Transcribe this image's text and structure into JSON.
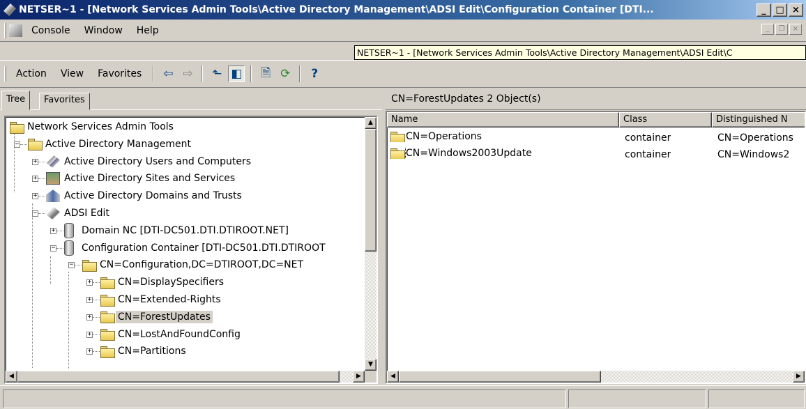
{
  "window": {
    "title": "NETSER~1 - [Network Services Admin Tools\\Active Directory Management\\ADSI Edit\\Configuration Container [DTI...",
    "app_icon": "mmc-icon",
    "buttons": {
      "minimize": "_",
      "maximize": "□",
      "close": "×"
    }
  },
  "menubar": {
    "items": [
      {
        "label": "Console",
        "icon": "console-icon"
      },
      {
        "label": "Window"
      },
      {
        "label": "Help"
      }
    ]
  },
  "tooltip": {
    "text": "NETSER~1 - [Network Services Admin Tools\\Active Directory Management\\ADSI Edit\\C"
  },
  "toolbar": {
    "menu_items": [
      "Action",
      "View",
      "Favorites"
    ],
    "buttons": [
      {
        "icon": "back-arrow-icon",
        "glyph": "⇦"
      },
      {
        "icon": "forward-arrow-icon",
        "glyph": "⇨"
      },
      {
        "icon": "up-one-level-icon",
        "glyph": "⬑"
      },
      {
        "icon": "show-hide-tree-icon",
        "glyph": "◧",
        "pressed": true
      },
      {
        "icon": "properties-icon",
        "glyph": "🗎"
      },
      {
        "icon": "refresh-icon",
        "glyph": "⟳"
      },
      {
        "icon": "help-icon",
        "glyph": "?"
      }
    ]
  },
  "left_pane": {
    "tabs": [
      {
        "label": "Tree",
        "active": true
      },
      {
        "label": "Favorites",
        "active": false
      }
    ],
    "tree": [
      {
        "label": "Network Services Admin Tools",
        "icon": "folder-icon",
        "level": 0,
        "expander": ""
      },
      {
        "label": "Active Directory Management",
        "icon": "folder-icon",
        "level": 1,
        "expander": "-"
      },
      {
        "label": "Active Directory Users and Computers",
        "icon": "ad-users-computers-icon",
        "level": 2,
        "expander": "+"
      },
      {
        "label": "Active Directory Sites and Services",
        "icon": "ad-sites-services-icon",
        "level": 2,
        "expander": "+"
      },
      {
        "label": "Active Directory Domains and Trusts",
        "icon": "ad-domains-trusts-icon",
        "level": 2,
        "expander": "+"
      },
      {
        "label": "ADSI Edit",
        "icon": "adsi-edit-icon",
        "level": 2,
        "expander": "-"
      },
      {
        "label": "Domain NC [DTI-DC501.DTI.DTIROOT.NET]",
        "icon": "naming-context-icon",
        "level": 3,
        "expander": "+"
      },
      {
        "label": "Configuration Container [DTI-DC501.DTI.DTIROOT",
        "icon": "naming-context-icon",
        "level": 3,
        "expander": "-"
      },
      {
        "label": "CN=Configuration,DC=DTIROOT,DC=NET",
        "icon": "folder-icon",
        "level": 4,
        "expander": "-"
      },
      {
        "label": "CN=DisplaySpecifiers",
        "icon": "folder-icon",
        "level": 5,
        "expander": "+"
      },
      {
        "label": "CN=Extended-Rights",
        "icon": "folder-icon",
        "level": 5,
        "expander": "+"
      },
      {
        "label": "CN=ForestUpdates",
        "icon": "folder-icon",
        "level": 5,
        "expander": "+",
        "selected": true
      },
      {
        "label": "CN=LostAndFoundConfig",
        "icon": "folder-icon",
        "level": 5,
        "expander": "+"
      },
      {
        "label": "CN=Partitions",
        "icon": "folder-icon",
        "level": 5,
        "expander": "+"
      }
    ]
  },
  "right_pane": {
    "header": "CN=ForestUpdates   2 Object(s)",
    "columns": [
      "Name",
      "Class",
      "Distinguished N"
    ],
    "rows": [
      {
        "name": "CN=Operations",
        "class": "container",
        "dn": "CN=Operations",
        "icon": "folder-icon"
      },
      {
        "name": "CN=Windows2003Update",
        "class": "container",
        "dn": "CN=Windows2",
        "icon": "folder-icon",
        "focused": true
      }
    ]
  }
}
